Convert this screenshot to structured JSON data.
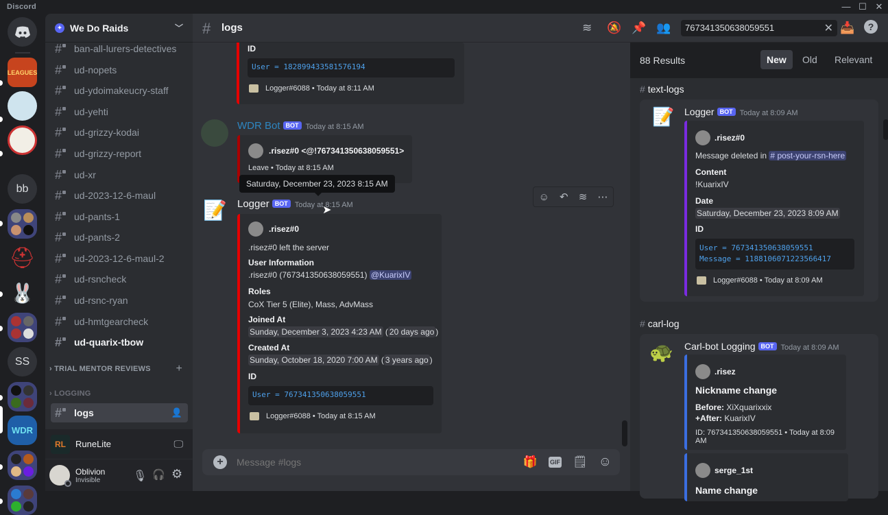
{
  "window": {
    "title": "Discord",
    "controls": [
      "minimize",
      "maximize",
      "close"
    ]
  },
  "guilds": [
    {
      "name": "Leagues IV",
      "type": "image",
      "color": "#c7441e"
    },
    {
      "name": "Christmas server",
      "type": "image",
      "color": "#cfe4ee"
    },
    {
      "name": "Crest server",
      "type": "image",
      "color": "#f2efe6"
    },
    {
      "name": "bb",
      "type": "text",
      "label": "bb"
    },
    {
      "name": "folder-1",
      "type": "folder"
    },
    {
      "name": "Santa helmet",
      "type": "image",
      "color": "#c6a24b"
    },
    {
      "name": "Bunny",
      "type": "image",
      "color": "#e6e0e0"
    },
    {
      "name": "folder-2",
      "type": "folder"
    },
    {
      "name": "SS",
      "type": "text",
      "label": "SS"
    },
    {
      "name": "folder-3",
      "type": "folder"
    },
    {
      "name": "WDR",
      "type": "image",
      "color": "#3c79c7",
      "selected": true
    },
    {
      "name": "folder-4",
      "type": "folder"
    },
    {
      "name": "folder-5",
      "type": "folder"
    }
  ],
  "server": {
    "name": "We Do Raids"
  },
  "channels": [
    {
      "name": "ban-all-lurers-detectives"
    },
    {
      "name": "ud-nopets"
    },
    {
      "name": "ud-ydoimakeucry-staff"
    },
    {
      "name": "ud-yehti"
    },
    {
      "name": "ud-grizzy-kodai"
    },
    {
      "name": "ud-grizzy-report"
    },
    {
      "name": "ud-xr"
    },
    {
      "name": "ud-2023-12-6-maul"
    },
    {
      "name": "ud-pants-1"
    },
    {
      "name": "ud-pants-2"
    },
    {
      "name": "ud-2023-12-6-maul-2"
    },
    {
      "name": "ud-rsncheck"
    },
    {
      "name": "ud-rsnc-ryan"
    },
    {
      "name": "ud-hmtgearcheck"
    },
    {
      "name": "ud-quarix-tbow",
      "unread": true
    }
  ],
  "categories": [
    {
      "name": "TRIAL MENTOR REVIEWS"
    },
    {
      "name": "LOGGING"
    }
  ],
  "active_channel": "logs",
  "activity": {
    "name": "RuneLite"
  },
  "user": {
    "name": "Oblivion",
    "status": "Invisible"
  },
  "header": {
    "channel": "logs",
    "search_value": "767341350638059551"
  },
  "messages": [
    {
      "embed": {
        "field": "ID",
        "code": "User = 182899433581576194",
        "footer": "Logger#6088 • Today at 8:11 AM"
      }
    },
    {
      "author": "WDR Bot",
      "badge": "BOT",
      "time": "Today at 8:15 AM",
      "embed": {
        "author": ".risez#0  <@!767341350638059551>",
        "footer": "Leave • Today at 8:15 AM"
      }
    },
    {
      "author": "Logger",
      "badge": "BOT",
      "time": "Today at 8:15 AM",
      "tooltip": "Saturday, December 23, 2023 8:15 AM",
      "embed": {
        "author": ".risez#0",
        "description": ".risez#0 left the server",
        "fields": [
          {
            "name": "User Information",
            "value": ".risez#0 (767341350638059551)",
            "mention": "@KuarixIV"
          },
          {
            "name": "Roles",
            "value": "CoX Tier 5 (Elite), Mass, AdvMass"
          },
          {
            "name": "Joined At",
            "date": "Sunday, December 3, 2023 4:23 AM",
            "relative": "20 days ago"
          },
          {
            "name": "Created At",
            "date": "Sunday, October 18, 2020 7:00 AM",
            "relative": "3 years ago"
          },
          {
            "name": "ID",
            "code": "User = 767341350638059551"
          }
        ],
        "footer": "Logger#6088 • Today at 8:15 AM"
      }
    }
  ],
  "composer": {
    "placeholder": "Message #logs"
  },
  "search_results": {
    "count": "88 Results",
    "sort": [
      {
        "label": "New",
        "active": true
      },
      {
        "label": "Old"
      },
      {
        "label": "Relevant"
      }
    ],
    "groups": [
      {
        "channel": "text-logs",
        "author": "Logger",
        "badge": "BOT",
        "time": "Today at 8:09 AM",
        "embed": {
          "author": ".risez#0",
          "desc_prefix": "Message deleted in",
          "channel_mention": "post-your-rsn-here",
          "content_label": "Content",
          "content": "!KuarixIV",
          "date_label": "Date",
          "date": "Saturday, December 23, 2023 8:09 AM",
          "id_label": "ID",
          "code1": "User = 767341350638059551",
          "code2": "Message = 1188106071223566417",
          "footer": "Logger#6088 • Today at 8:09 AM"
        }
      },
      {
        "channel": "carl-log",
        "author": "Carl-bot Logging",
        "badge": "BOT",
        "time": "Today at 8:09 AM",
        "embed": {
          "author": ".risez",
          "title": "Nickname change",
          "before_label": "Before:",
          "before": "XiXquarixxix",
          "after_label": "+After:",
          "after": "KuarixIV",
          "footer": "ID: 767341350638059551 • Today at 8:09 AM"
        },
        "embed2": {
          "author": "serge_1st",
          "title": "Name change"
        }
      }
    ]
  }
}
